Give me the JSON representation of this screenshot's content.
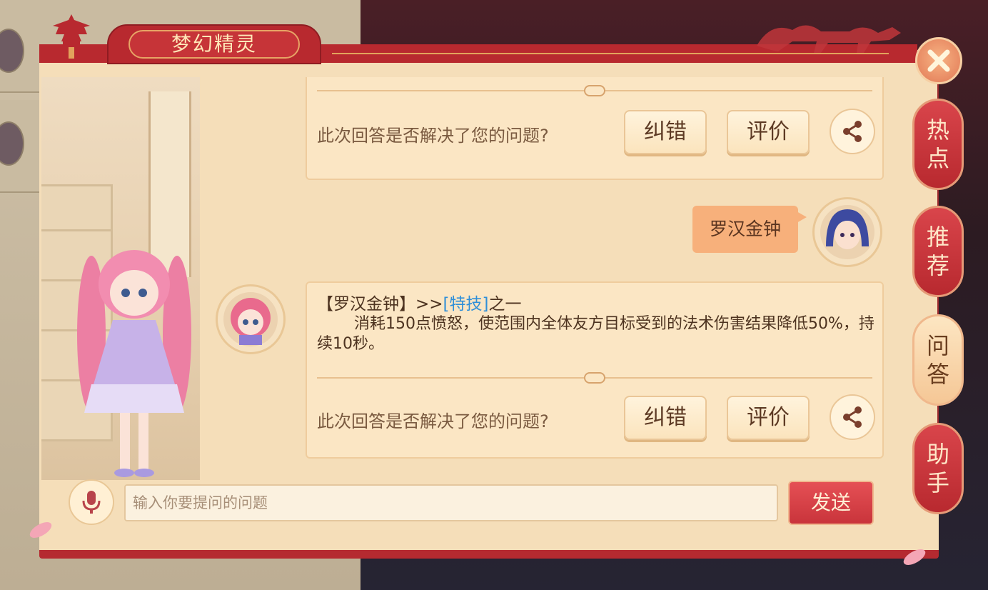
{
  "window": {
    "title": "梦幻精灵"
  },
  "chat": {
    "feedback_prompt": "此次回答是否解决了您的问题?",
    "correct_label": "纠错",
    "rate_label": "评价",
    "user_message": "罗汉金钟",
    "answer": {
      "title_prefix": "【罗汉金钟】>>",
      "link_text": "[特技]",
      "title_suffix": "之一",
      "body": "消耗150点愤怒，使范围内全体友方目标受到的法术伤害结果降低50%，持续10秒。"
    }
  },
  "input": {
    "placeholder": "输入你要提问的问题",
    "value": ""
  },
  "send_label": "发送",
  "side_tabs": [
    {
      "line1": "热",
      "line2": "点",
      "active": false
    },
    {
      "line1": "推",
      "line2": "荐",
      "active": false
    },
    {
      "line1": "问",
      "line2": "答",
      "active": true
    },
    {
      "line1": "助",
      "line2": "手",
      "active": false
    }
  ],
  "icons": {
    "close": "close-icon",
    "share": "share-icon",
    "mic": "microphone-icon"
  },
  "colors": {
    "accent_red": "#b8292f",
    "panel_bg": "#f5deb9",
    "link_blue": "#2f8fd8",
    "user_bubble": "#f7b07b"
  }
}
